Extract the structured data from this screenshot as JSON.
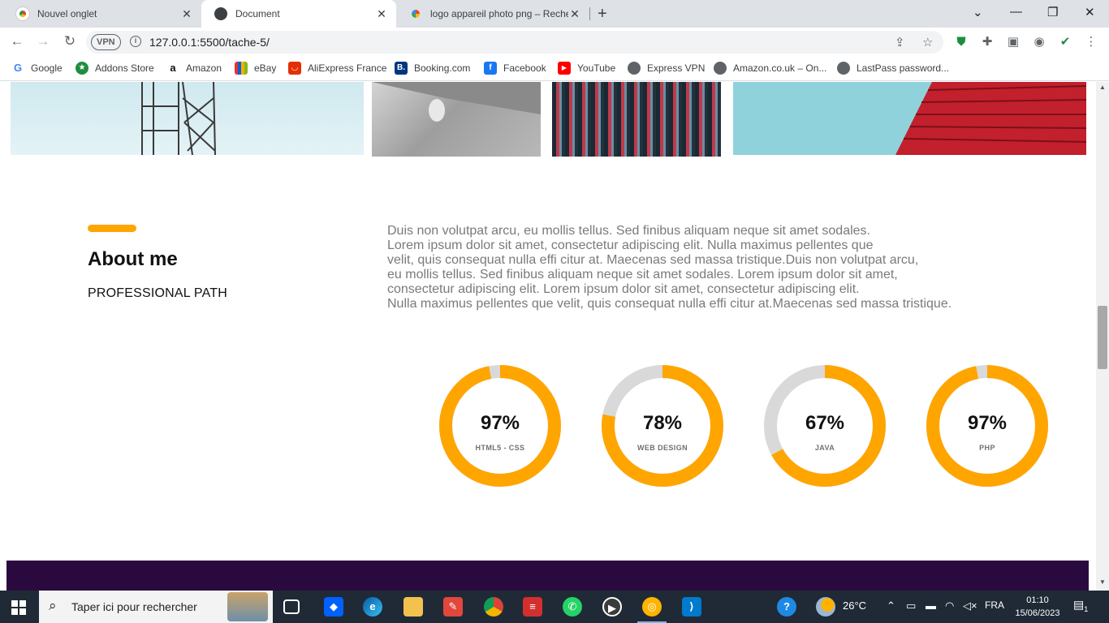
{
  "browser": {
    "tabs": [
      {
        "title": "Nouvel onglet",
        "close": "✕",
        "active": false
      },
      {
        "title": "Document",
        "close": "✕",
        "active": true
      },
      {
        "title": "logo appareil photo png – Reche",
        "close": "✕",
        "active": false
      }
    ],
    "new_tab": "+",
    "window_controls": {
      "dropdown": "⌄",
      "minimize": "—",
      "restore": "❐",
      "close": "✕"
    },
    "nav": {
      "back": "←",
      "forward": "→",
      "reload": "↻"
    },
    "vpn_badge": "VPN",
    "address": "127.0.0.1:5500/tache-5/",
    "bookmarks": [
      {
        "label": "Google",
        "icon": "google-icon",
        "color": "#4285f4"
      },
      {
        "label": "Addons Store",
        "icon": "addons-icon",
        "color": "#1e8e3e"
      },
      {
        "label": "Amazon",
        "icon": "amazon-icon",
        "color": "#232f3e"
      },
      {
        "label": "eBay",
        "icon": "ebay-icon",
        "color": "#e53238"
      },
      {
        "label": "AliExpress France",
        "icon": "aliexpress-icon",
        "color": "#e62e04"
      },
      {
        "label": "Booking.com",
        "icon": "booking-icon",
        "color": "#003580"
      },
      {
        "label": "Facebook",
        "icon": "facebook-icon",
        "color": "#1877f2"
      },
      {
        "label": "YouTube",
        "icon": "youtube-icon",
        "color": "#ff0000"
      },
      {
        "label": "Express VPN",
        "icon": "globe-icon",
        "color": "#5f6368"
      },
      {
        "label": "Amazon.co.uk – On...",
        "icon": "globe-icon",
        "color": "#5f6368"
      },
      {
        "label": "LastPass password...",
        "icon": "globe-icon",
        "color": "#5f6368"
      }
    ]
  },
  "page": {
    "about": {
      "title": "About me",
      "subtitle": "PROFESSIONAL PATH",
      "paragraph_lines": [
        "Duis non volutpat arcu, eu mollis tellus. Sed finibus aliquam neque sit amet sodales.",
        "Lorem ipsum dolor sit amet, consectetur adipiscing elit. Nulla maximus pellentes que",
        "velit, quis consequat nulla effi citur at. Maecenas sed massa tristique.Duis non volutpat arcu,",
        "eu mollis tellus. Sed finibus aliquam neque sit amet sodales. Lorem ipsum dolor sit amet,",
        "consectetur adipiscing elit. Lorem ipsum dolor sit amet, consectetur adipiscing elit.",
        "Nulla maximus pellentes que velit, quis consequat nulla effi citur at.Maecenas sed massa tristique."
      ]
    },
    "skills": [
      {
        "percent_text": "97%",
        "value": 97,
        "label": "HTML5 - CSS"
      },
      {
        "percent_text": "78%",
        "value": 78,
        "label": "WEB DESIGN"
      },
      {
        "percent_text": "67%",
        "value": 67,
        "label": "JAVA"
      },
      {
        "percent_text": "97%",
        "value": 97,
        "label": "PHP"
      }
    ],
    "colors": {
      "accent": "#ffa500",
      "track": "#d9d9d9",
      "footer": "#2a0a3e"
    }
  },
  "taskbar": {
    "search_placeholder": "Taper ici pour rechercher",
    "weather": "26°C",
    "language": "FRA",
    "time": "01:10",
    "date": "15/06/2023",
    "notification_count": "1"
  }
}
